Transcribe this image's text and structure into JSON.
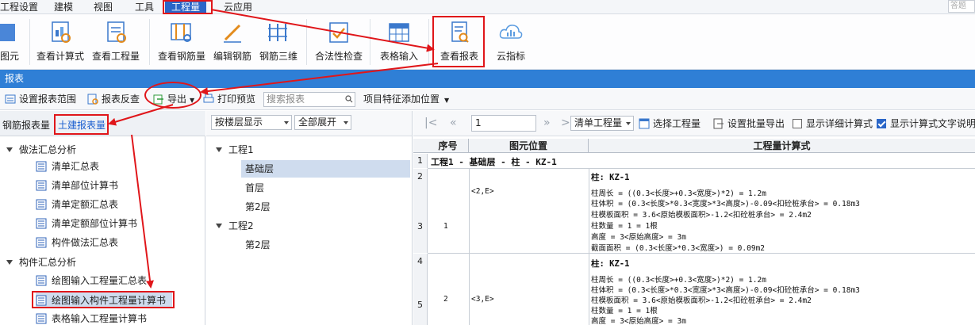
{
  "menubar": {
    "items": [
      "工程设置",
      "建模",
      "视图",
      "工具",
      "工程量",
      "云应用"
    ],
    "active_index": 4,
    "search_placeholder": "答题"
  },
  "ribbon": {
    "buttons": [
      "图元",
      "查看计算式",
      "查看工程量",
      "查看钢筋量",
      "编辑钢筋",
      "钢筋三维",
      "合法性检查",
      "表格输入",
      "查看报表",
      "云指标"
    ]
  },
  "panel_title": "报表",
  "toolbar": {
    "set_range": "设置报表范围",
    "report_check": "报表反查",
    "export": "导出",
    "print_preview": "打印预览",
    "search_placeholder": "搜索报表",
    "add_feature": "项目特征添加位置"
  },
  "left_tabs": {
    "rebar": "钢筋报表量",
    "civil": "土建报表量"
  },
  "tree": {
    "group1": "做法汇总分析",
    "group1_items": [
      "清单汇总表",
      "清单部位计算书",
      "清单定额汇总表",
      "清单定额部位计算书",
      "构件做法汇总表"
    ],
    "group2": "构件汇总分析",
    "group2_items": [
      "绘图输入工程量汇总表",
      "绘图输入构件工程量计算书",
      "表格输入工程量计算书"
    ]
  },
  "middle": {
    "floor_select": "按楼层显示",
    "expand_select": "全部展开",
    "project1": "工程1",
    "project1_floors": [
      "基础层",
      "首层",
      "第2层"
    ],
    "project2": "工程2",
    "project2_floors": [
      "第2层"
    ]
  },
  "right": {
    "pager_first": "|<",
    "pager_prev": "«",
    "pager_next": "»",
    "pager_last": ">|",
    "page_value": "1",
    "qty_select": "清单工程量",
    "select_qty": "选择工程量",
    "batch_export": "设置批量导出",
    "show_detail": "显示详细计算式",
    "show_text": "显示计算式文字说明",
    "show_detail_checked": false,
    "show_text_checked": true
  },
  "grid": {
    "headers": [
      "序号",
      "图元位置",
      "工程量计算式"
    ],
    "row_numbers": [
      "1",
      "2",
      "3",
      "4",
      "5"
    ],
    "group_row": "工程1 - 基础层 - 柱 - KZ-1",
    "entries": [
      {
        "seq": "1",
        "position": "<2,E>",
        "title": "柱: KZ-1",
        "lines": [
          "柱周长 = ((0.3<长度>+0.3<宽度>)*2) = 1.2m",
          "柱体积 = (0.3<长度>*0.3<宽度>*3<高度>)-0.09<扣砼桩承台> = 0.18m3",
          "柱模板面积 = 3.6<原始模板面积>-1.2<扣砼桩承台> = 2.4m2",
          "柱数量 = 1 = 1根",
          "高度 = 3<原始高度> = 3m",
          "截面面积 = (0.3<长度>*0.3<宽度>) = 0.09m2"
        ]
      },
      {
        "seq": "2",
        "position": "<3,E>",
        "title": "柱: KZ-1",
        "lines": [
          "柱周长 = ((0.3<长度>+0.3<宽度>)*2) = 1.2m",
          "柱体积 = (0.3<长度>*0.3<宽度>*3<高度>)-0.09<扣砼桩承台> = 0.18m3",
          "柱模板面积 = 3.6<原始模板面积>-1.2<扣砼桩承台> = 2.4m2",
          "柱数量 = 1 = 1根",
          "高度 = 3<原始高度> = 3m"
        ]
      }
    ]
  },
  "colors": {
    "accent_blue": "#2f7fd6",
    "menu_active": "#2a66c8",
    "annotation_red": "#e0161a",
    "selection": "#cfdcee"
  }
}
